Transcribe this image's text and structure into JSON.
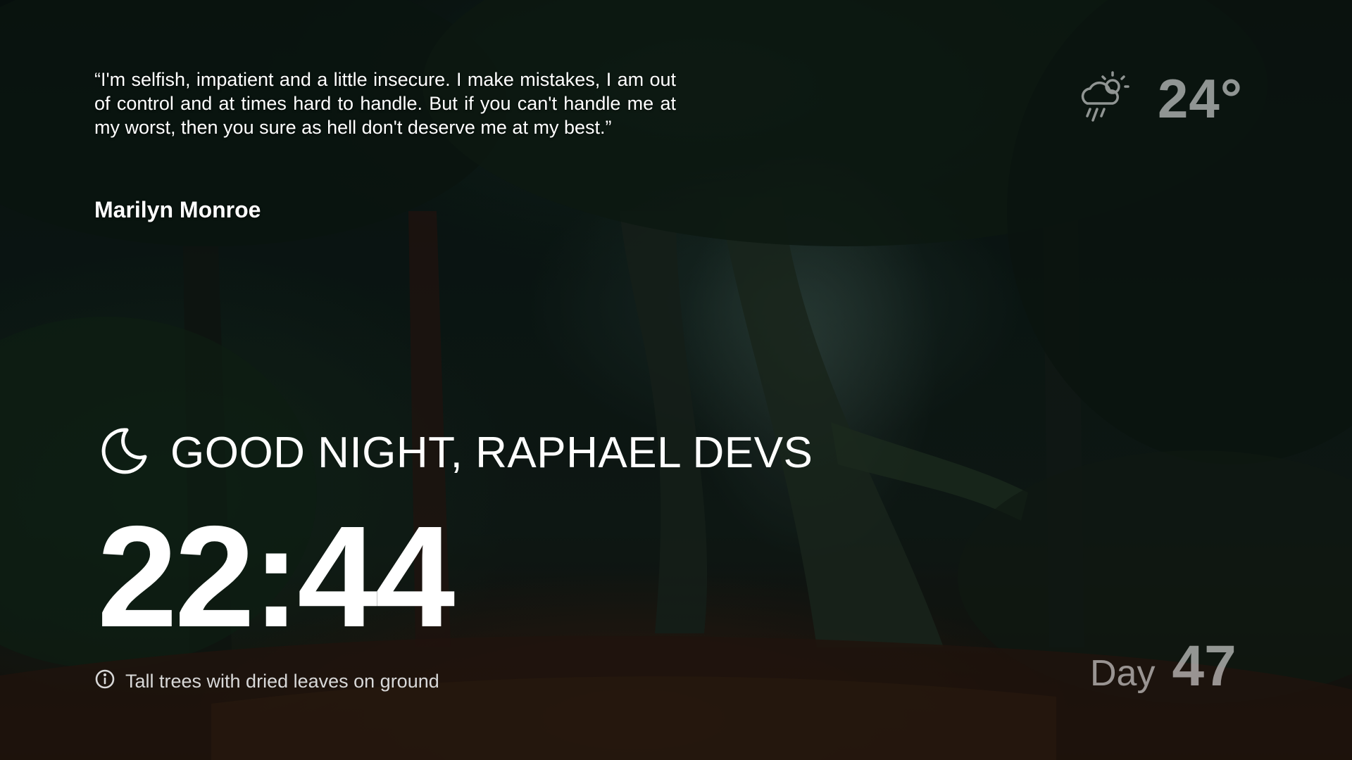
{
  "quote": {
    "text": "“I'm selfish, impatient and a little insecure. I make mistakes, I am out of control and at times hard to handle. But if you can't handle me at my worst, then you sure as hell don't deserve me at my best.”",
    "author": "Marilyn Monroe"
  },
  "weather": {
    "icon": "rain-sun-icon",
    "temperature": "24°"
  },
  "greeting": {
    "icon": "moon-icon",
    "text": "GOOD NIGHT, RAPHAEL DEVS"
  },
  "clock": {
    "time": "22:44"
  },
  "photo": {
    "icon": "info-icon",
    "description": "Tall trees with dried leaves on ground"
  },
  "day_counter": {
    "label": "Day",
    "value": "47"
  },
  "colors": {
    "text": "#ffffff",
    "muted_text": "#d8d8d8",
    "forest_dark": "#0b1613",
    "ground": "#3a2414"
  }
}
